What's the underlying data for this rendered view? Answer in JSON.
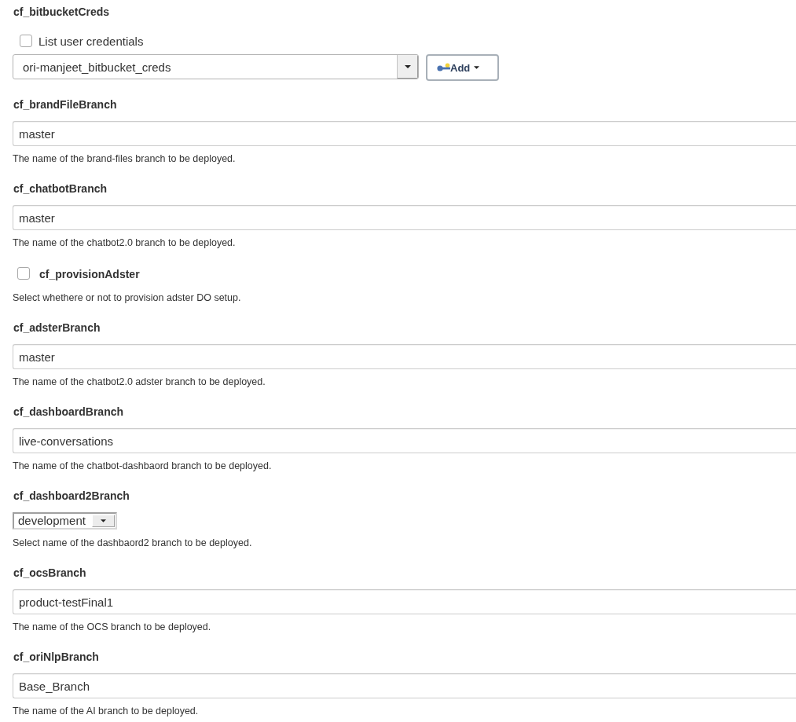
{
  "fields": [
    {
      "kind": "credentials",
      "label": "cf_bitbucketCreds",
      "checkbox": {
        "label": "List user credentials",
        "checked": false
      },
      "value": "ori-manjeet_bitbucket_creds",
      "add_button": "Add"
    },
    {
      "kind": "text",
      "label": "cf_brandFileBranch",
      "value": "master",
      "help": "The name of the brand-files branch to be deployed."
    },
    {
      "kind": "text",
      "label": "cf_chatbotBranch",
      "value": "master",
      "help": "The name of the chatbot2.0 branch to be deployed."
    },
    {
      "kind": "checkbox",
      "label": "cf_provisionAdster",
      "checked": false,
      "help": "Select whethere or not to provision adster DO setup."
    },
    {
      "kind": "text",
      "label": "cf_adsterBranch",
      "value": "master",
      "help": "The name of the chatbot2.0 adster branch to be deployed."
    },
    {
      "kind": "text",
      "label": "cf_dashboardBranch",
      "value": "live-conversations",
      "help": "The name of the chatbot-dashbaord branch to be deployed."
    },
    {
      "kind": "select",
      "label": "cf_dashboard2Branch",
      "value": "development",
      "help": "Select name of the dashbaord2 branch to be deployed."
    },
    {
      "kind": "text",
      "label": "cf_ocsBranch",
      "value": "product-testFinal1",
      "help": "The name of the OCS branch to be deployed."
    },
    {
      "kind": "text",
      "label": "cf_oriNlpBranch",
      "value": "Base_Branch",
      "help": "The name of the AI branch to be deployed."
    }
  ]
}
